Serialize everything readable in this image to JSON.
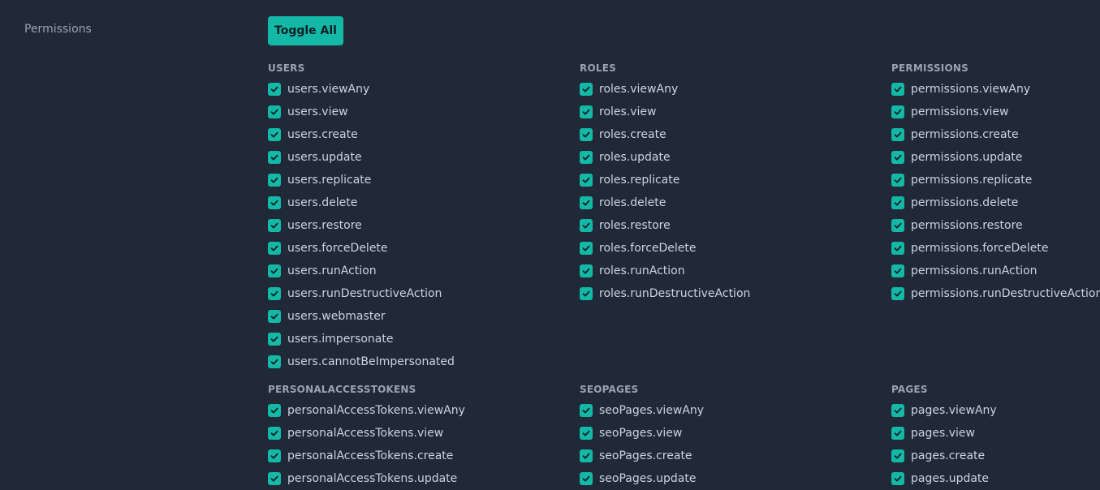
{
  "field": {
    "label": "Permissions"
  },
  "toggle_all": {
    "label": "Toggle All"
  },
  "colors": {
    "accent": "#14b8a6",
    "background": "#1f2937"
  },
  "groups": [
    {
      "title": "USERS",
      "items": [
        "users.viewAny",
        "users.view",
        "users.create",
        "users.update",
        "users.replicate",
        "users.delete",
        "users.restore",
        "users.forceDelete",
        "users.runAction",
        "users.runDestructiveAction",
        "users.webmaster",
        "users.impersonate",
        "users.cannotBeImpersonated"
      ]
    },
    {
      "title": "ROLES",
      "items": [
        "roles.viewAny",
        "roles.view",
        "roles.create",
        "roles.update",
        "roles.replicate",
        "roles.delete",
        "roles.restore",
        "roles.forceDelete",
        "roles.runAction",
        "roles.runDestructiveAction"
      ]
    },
    {
      "title": "PERMISSIONS",
      "items": [
        "permissions.viewAny",
        "permissions.view",
        "permissions.create",
        "permissions.update",
        "permissions.replicate",
        "permissions.delete",
        "permissions.restore",
        "permissions.forceDelete",
        "permissions.runAction",
        "permissions.runDestructiveAction"
      ]
    },
    {
      "title": "PERSONALACCESSTOKENS",
      "items": [
        "personalAccessTokens.viewAny",
        "personalAccessTokens.view",
        "personalAccessTokens.create",
        "personalAccessTokens.update"
      ]
    },
    {
      "title": "SEOPAGES",
      "items": [
        "seoPages.viewAny",
        "seoPages.view",
        "seoPages.create",
        "seoPages.update"
      ]
    },
    {
      "title": "PAGES",
      "items": [
        "pages.viewAny",
        "pages.view",
        "pages.create",
        "pages.update"
      ]
    }
  ]
}
